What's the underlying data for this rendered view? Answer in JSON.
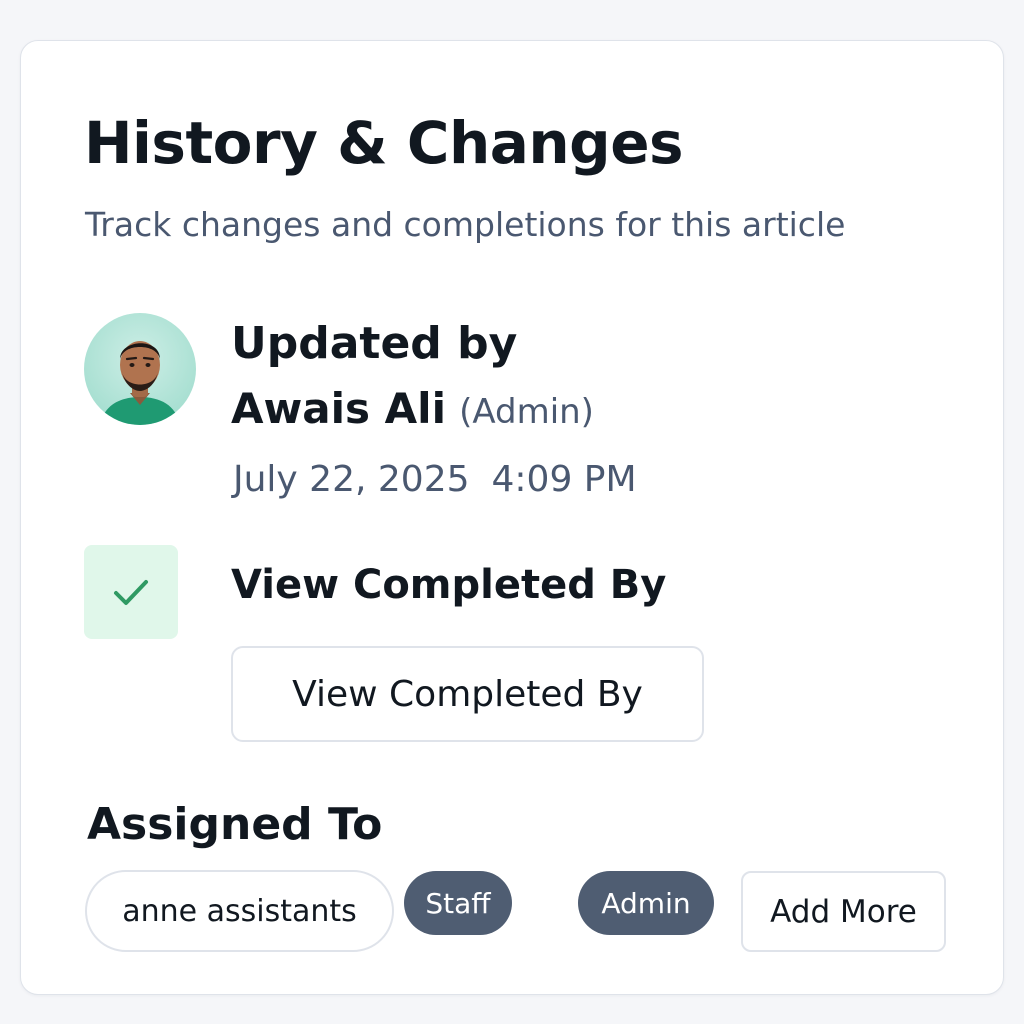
{
  "panel": {
    "title": "History & Changes",
    "subtitle": "Track changes and completions for this article"
  },
  "update": {
    "label": "Updated by",
    "user_name": "Awais Ali",
    "user_role": "(Admin)",
    "date": "July 22, 2025",
    "time": "4:09 PM",
    "avatar_icon": "user-avatar"
  },
  "completion": {
    "icon": "checkmark-icon",
    "heading": "View Completed By",
    "button_label": "View Completed By"
  },
  "assigned": {
    "heading": "Assigned To",
    "user_chip": "anne assistants",
    "roles": [
      "Staff",
      "Admin"
    ],
    "add_button": "Add More"
  },
  "colors": {
    "text_primary": "#111820",
    "text_secondary": "#4a5870",
    "check_bg": "#e0f7ea",
    "check_mark": "#2f9a63",
    "role_chip_bg": "#4f5d72",
    "border": "#dfe3ea"
  }
}
